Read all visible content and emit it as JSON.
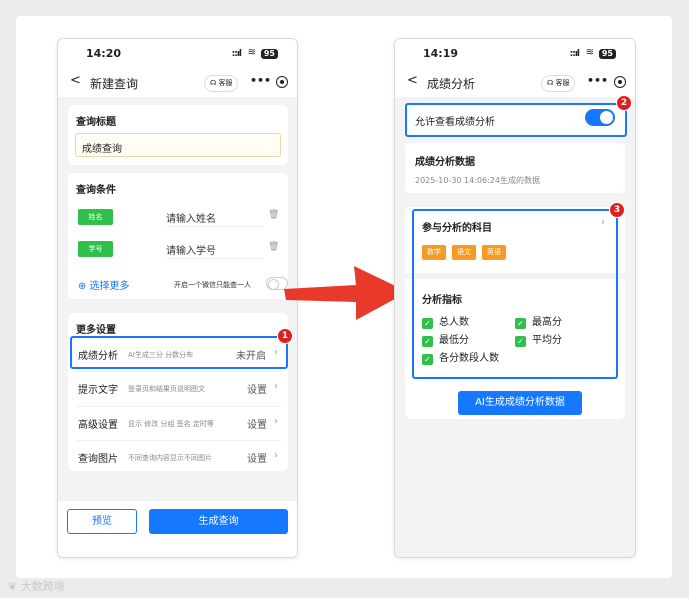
{
  "left": {
    "status": {
      "time": "14:20",
      "signal": "::ıl",
      "wifi": "≋",
      "battery": "95"
    },
    "nav": {
      "back": "<",
      "title": "新建查询",
      "kefu": "客服",
      "more": "•••"
    },
    "query_title": {
      "label": "查询标题",
      "value": "成绩查询"
    },
    "conditions": {
      "label": "查询条件",
      "items": [
        {
          "tag": "姓名",
          "placeholder": "请输入姓名"
        },
        {
          "tag": "学号",
          "placeholder": "请输入学号"
        }
      ],
      "more_link": "⊕ 选择更多",
      "limit_text": "开启一个微信只能查一人"
    },
    "more_settings": {
      "label": "更多设置",
      "rows": [
        {
          "label": "成绩分析",
          "desc": "AI生成三分 分数分布",
          "value": "未开启"
        },
        {
          "label": "提示文字",
          "desc": "登录页和结果页说明图文",
          "value": "设置"
        },
        {
          "label": "高级设置",
          "desc": "显示 修改 分组 签名 定时等",
          "value": "设置"
        },
        {
          "label": "查询图片",
          "desc": "不同查询内容显示不同图片",
          "value": "设置"
        }
      ]
    },
    "footer": {
      "preview": "预览",
      "generate": "生成查询"
    }
  },
  "right": {
    "status": {
      "time": "14:19",
      "signal": "::ıl",
      "wifi": "≋",
      "battery": "95"
    },
    "nav": {
      "back": "<",
      "title": "成绩分析",
      "kefu": "客服",
      "more": "•••"
    },
    "allow": {
      "label": "允许查看成绩分析"
    },
    "data_section": {
      "title": "成绩分析数据",
      "subtitle": "2025-10-30 14:06:24生成的数据"
    },
    "subjects": {
      "title": "参与分析的科目",
      "chips": [
        "数学",
        "语文",
        "英语"
      ]
    },
    "metrics": {
      "title": "分析指标",
      "items": [
        "总人数",
        "最高分",
        "最低分",
        "平均分",
        "各分数段人数"
      ]
    },
    "generate_btn": "AI生成成绩分析数据"
  },
  "badges": [
    "1",
    "2",
    "3"
  ],
  "watermark": "大数跨境",
  "colors": {
    "primary": "#1677ff",
    "green": "#2fbf4a",
    "orange": "#f59a23",
    "red": "#e02020",
    "arrow": "#e8392a"
  }
}
